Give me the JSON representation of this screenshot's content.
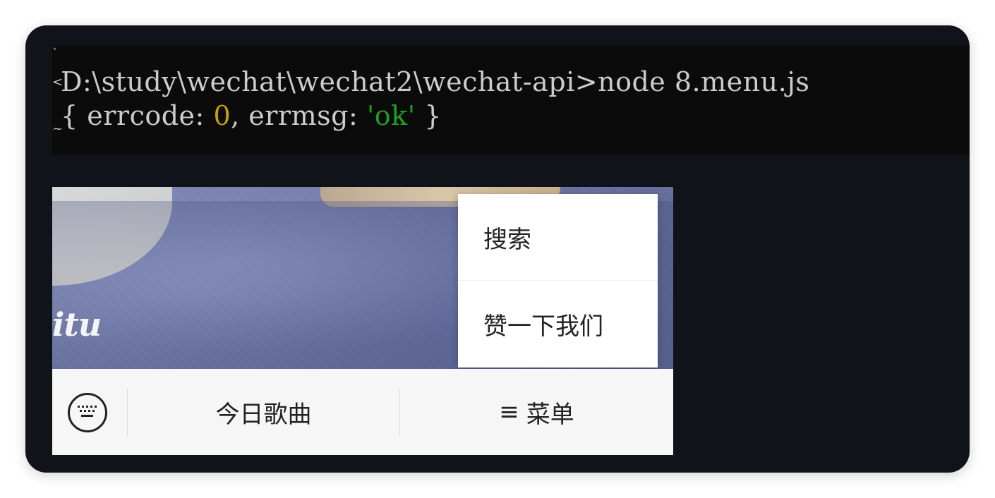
{
  "terminal": {
    "command_line": "D:\\study\\wechat\\wechat2\\wechat-api>node 8.menu.js",
    "output": {
      "open": "{ errcode: ",
      "errcode": "0",
      "mid": ", errmsg: ",
      "errmsg": "'ok'",
      "close": " }"
    },
    "edge_marks": [
      "`",
      "<",
      "~"
    ],
    "colors": {
      "background": "#0b0b0b",
      "text": "#cccccc",
      "number": "#c8a100",
      "string": "#20a020"
    }
  },
  "wechat": {
    "photo_text": "itu",
    "popup_menu": {
      "items": [
        {
          "label": "搜索"
        },
        {
          "label": "赞一下我们"
        }
      ]
    },
    "bottom_bar": {
      "keyboard_icon": "keyboard-icon",
      "song_button": "今日歌曲",
      "menu_glyph": "≡",
      "menu_button": "菜单"
    }
  }
}
